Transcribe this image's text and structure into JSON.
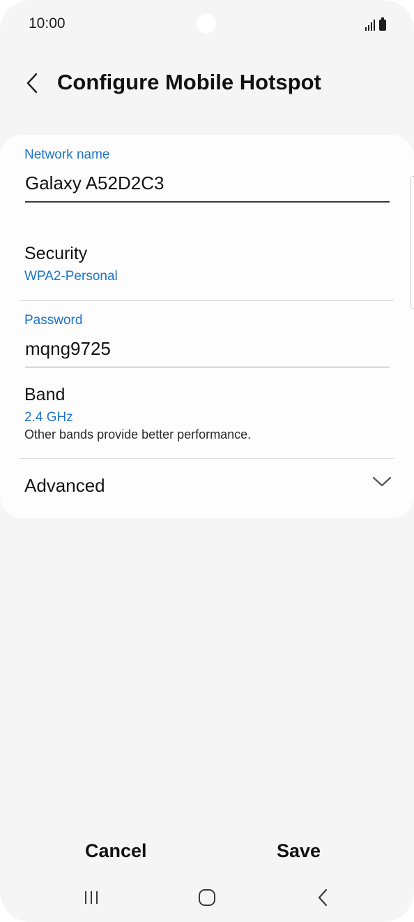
{
  "status_bar": {
    "time": "10:00",
    "icons": [
      "signal-icon",
      "battery-icon"
    ]
  },
  "header": {
    "back_icon": "chevron-left-icon",
    "title": "Configure Mobile Hotspot"
  },
  "form": {
    "network_name": {
      "label": "Network name",
      "value": "Galaxy A52D2C3"
    },
    "security": {
      "title": "Security",
      "value": "WPA2-Personal"
    },
    "password": {
      "label": "Password",
      "value": "mqng9725"
    },
    "band": {
      "title": "Band",
      "value": "2.4 GHz",
      "description": "Other bands provide better performance."
    },
    "advanced": {
      "title": "Advanced",
      "icon": "chevron-down-icon"
    }
  },
  "actions": {
    "cancel_label": "Cancel",
    "save_label": "Save"
  },
  "nav_bar": {
    "icons": [
      "recent-apps-icon",
      "home-icon",
      "back-icon"
    ]
  },
  "colors": {
    "accent": "#1f74c8",
    "background": "#f5f5f5",
    "card": "#fdfdfd",
    "text": "#141414"
  }
}
